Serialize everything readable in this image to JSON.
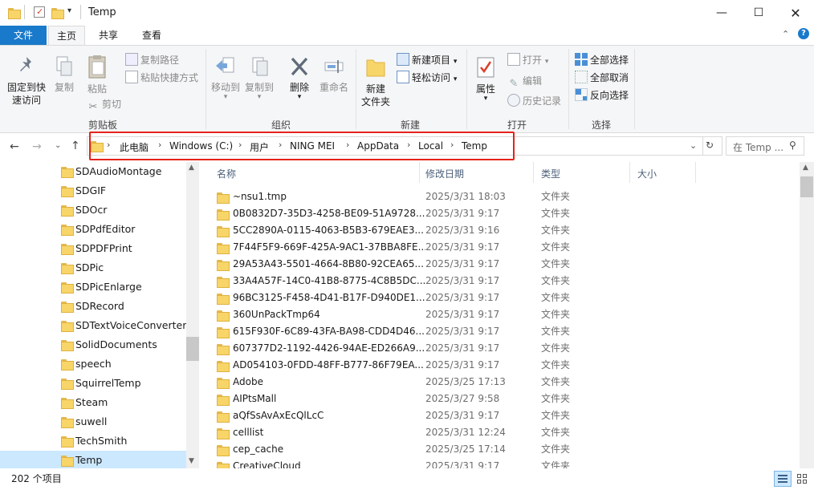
{
  "window": {
    "title": "Temp"
  },
  "tabs": [
    {
      "label": "文件"
    },
    {
      "label": "主页"
    },
    {
      "label": "共享"
    },
    {
      "label": "查看"
    }
  ],
  "ribbon": {
    "clipboard": {
      "pin": "固定到快速访问",
      "pin_l1": "固定到快",
      "pin_l2": "速访问",
      "copy": "复制",
      "paste": "粘贴",
      "copy_path": "复制路径",
      "paste_shortcut": "粘贴快捷方式",
      "cut": "剪切",
      "label": "剪贴板"
    },
    "organize": {
      "move_to": "移动到",
      "copy_to": "复制到",
      "delete": "删除",
      "rename": "重命名",
      "label": "组织"
    },
    "new": {
      "new_item": "新建项目",
      "easy_access": "轻松访问",
      "new_folder_l1": "新建",
      "new_folder_l2": "文件夹",
      "label": "新建"
    },
    "open": {
      "properties": "属性",
      "open": "打开",
      "edit": "编辑",
      "history": "历史记录",
      "label": "打开"
    },
    "select": {
      "select_all": "全部选择",
      "select_none": "全部取消",
      "invert": "反向选择",
      "label": "选择"
    }
  },
  "address": {
    "crumbs": [
      "此电脑",
      "Windows (C:)",
      "用户",
      "NING MEI",
      "AppData",
      "Local",
      "Temp"
    ],
    "search_placeholder": "在 Temp ..."
  },
  "nav": {
    "items": [
      {
        "label": "SDAudioMontage"
      },
      {
        "label": "SDGIF"
      },
      {
        "label": "SDOcr"
      },
      {
        "label": "SDPdfEditor"
      },
      {
        "label": "SDPDFPrint"
      },
      {
        "label": "SDPic"
      },
      {
        "label": "SDPicEnlarge"
      },
      {
        "label": "SDRecord"
      },
      {
        "label": "SDTextVoiceConverter"
      },
      {
        "label": "SolidDocuments"
      },
      {
        "label": "speech"
      },
      {
        "label": "SquirrelTemp"
      },
      {
        "label": "Steam"
      },
      {
        "label": "suwell"
      },
      {
        "label": "TechSmith"
      },
      {
        "label": "Temp"
      }
    ],
    "selected": "Temp"
  },
  "columns": {
    "name": "名称",
    "date": "修改日期",
    "type": "类型",
    "size": "大小"
  },
  "files": [
    {
      "name": "~nsu1.tmp",
      "date": "2025/3/31 18:03",
      "type": "文件夹"
    },
    {
      "name": "0B0832D7-35D3-4258-BE09-51A9728...",
      "date": "2025/3/31 9:17",
      "type": "文件夹"
    },
    {
      "name": "5CC2890A-0115-4063-B5B3-679EAE3...",
      "date": "2025/3/31 9:16",
      "type": "文件夹"
    },
    {
      "name": "7F44F5F9-669F-425A-9AC1-37BBA8FE...",
      "date": "2025/3/31 9:17",
      "type": "文件夹"
    },
    {
      "name": "29A53A43-5501-4664-8B80-92CEA65...",
      "date": "2025/3/31 9:17",
      "type": "文件夹"
    },
    {
      "name": "33A4A57F-14C0-41B8-8775-4C8B5DC...",
      "date": "2025/3/31 9:17",
      "type": "文件夹"
    },
    {
      "name": "96BC3125-F458-4D41-B17F-D940DE1...",
      "date": "2025/3/31 9:17",
      "type": "文件夹"
    },
    {
      "name": "360UnPackTmp64",
      "date": "2025/3/31 9:17",
      "type": "文件夹"
    },
    {
      "name": "615F930F-6C89-43FA-BA98-CDD4D46...",
      "date": "2025/3/31 9:17",
      "type": "文件夹"
    },
    {
      "name": "607377D2-1192-4426-94AE-ED266A9...",
      "date": "2025/3/31 9:17",
      "type": "文件夹"
    },
    {
      "name": "AD054103-0FDD-48FF-B777-86F79EA...",
      "date": "2025/3/31 9:17",
      "type": "文件夹"
    },
    {
      "name": "Adobe",
      "date": "2025/3/25 17:13",
      "type": "文件夹"
    },
    {
      "name": "AIPtsMall",
      "date": "2025/3/27 9:58",
      "type": "文件夹"
    },
    {
      "name": "aQfSsAvAxEcQlLcC",
      "date": "2025/3/31 9:17",
      "type": "文件夹"
    },
    {
      "name": "celllist",
      "date": "2025/3/31 12:24",
      "type": "文件夹"
    },
    {
      "name": "cep_cache",
      "date": "2025/3/25 17:14",
      "type": "文件夹"
    },
    {
      "name": "CreativeCloud",
      "date": "2025/3/31 9:17",
      "type": "文件夹"
    }
  ],
  "status": {
    "count": "202 个项目"
  },
  "colors": {
    "accent": "#1979ca",
    "highlight": "#e5231b",
    "folder": "#f8d568",
    "selection": "#cce8ff"
  }
}
